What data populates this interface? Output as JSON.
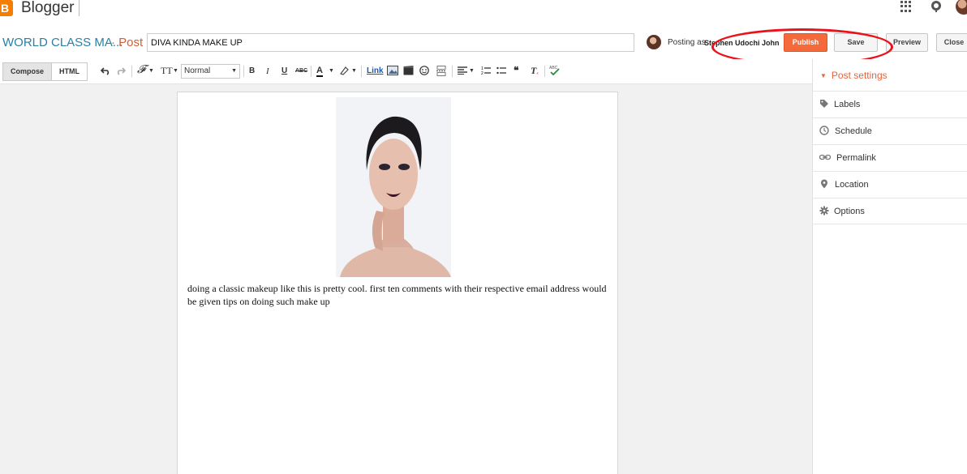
{
  "app": {
    "logo_letter": "B",
    "brand": "Blogger"
  },
  "post": {
    "blog_title": "WORLD CLASS MA...",
    "crumb": "· Post",
    "title_value": "DIVA KINDA MAKE UP",
    "posting_as_label": "Posting as",
    "poster_name": "Stephen Udochi John",
    "body_text": "doing a classic makeup like this is pretty cool. first ten comments with their respective email address would be given tips on doing such make up"
  },
  "actions": {
    "publish": "Publish",
    "save": "Save",
    "preview": "Preview",
    "close": "Close"
  },
  "toolbar": {
    "compose": "Compose",
    "html": "HTML",
    "format": "Normal",
    "bold": "B",
    "italic": "I",
    "underline": "U",
    "strike": "ABC",
    "link": "Link"
  },
  "sidebar": {
    "header": "Post settings",
    "items": [
      {
        "label": "Labels",
        "icon": "tag-icon"
      },
      {
        "label": "Schedule",
        "icon": "clock-icon"
      },
      {
        "label": "Permalink",
        "icon": "link-icon"
      },
      {
        "label": "Location",
        "icon": "location-pin-icon"
      },
      {
        "label": "Options",
        "icon": "gear-icon"
      }
    ]
  },
  "colors": {
    "accent": "#f46a3a",
    "blog_title": "#2a7fa4",
    "annotation": "#e8131b"
  }
}
